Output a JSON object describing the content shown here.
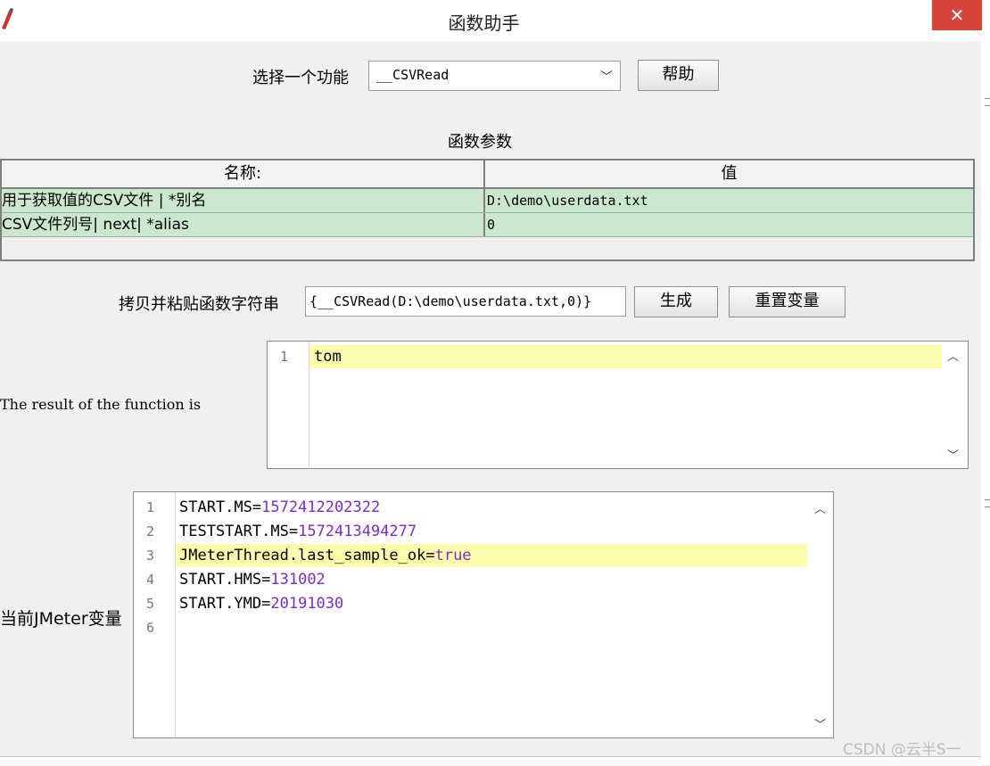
{
  "window": {
    "title": "函数助手",
    "close_glyph": "✕",
    "icon": "pencil-icon"
  },
  "selector": {
    "label": "选择一个功能",
    "selected": "__CSVRead",
    "help_label": "帮助"
  },
  "params": {
    "section_title": "函数参数",
    "columns": [
      "名称:",
      "值"
    ],
    "rows": [
      {
        "name": "用于获取值的CSV文件 | *别名",
        "value": "D:\\demo\\userdata.txt"
      },
      {
        "name": "CSV文件列号| next| *alias",
        "value": "0"
      }
    ]
  },
  "function_string": {
    "label": "拷贝并粘贴函数字符串",
    "value": "{__CSVRead(D:\\demo\\userdata.txt,0)}",
    "generate_label": "生成",
    "reset_label": "重置变量"
  },
  "result": {
    "label": "The result of the function is",
    "lines": [
      {
        "n": "1",
        "text": "tom"
      }
    ]
  },
  "variables": {
    "label": "当前JMeter变量",
    "lines": [
      {
        "n": "1",
        "key": "START.MS",
        "value": "1572412202322"
      },
      {
        "n": "2",
        "key": "TESTSTART.MS",
        "value": "1572413494277"
      },
      {
        "n": "3",
        "key": "JMeterThread.last_sample_ok",
        "value": "true"
      },
      {
        "n": "4",
        "key": "START.HMS",
        "value": "131002"
      },
      {
        "n": "5",
        "key": "START.YMD",
        "value": "20191030"
      },
      {
        "n": "6",
        "key": "",
        "value": ""
      }
    ]
  },
  "watermark": "CSDN @云半S一",
  "colors": {
    "row_bg": "#cbe7cd",
    "highlight": "#fdfcad",
    "number": "#7a2fc1",
    "close_bg": "#d9443a"
  }
}
